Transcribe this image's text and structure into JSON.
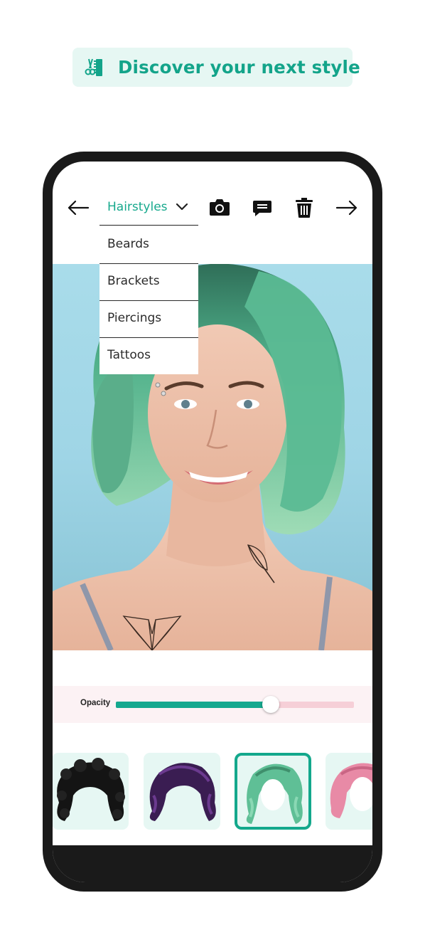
{
  "banner": {
    "icon": "scissors-comb-icon",
    "text": "Discover your next style",
    "color": "#13a48a",
    "background": "#e6f7f3"
  },
  "toolbar": {
    "back_icon": "arrow-left-icon",
    "forward_icon": "arrow-right-icon",
    "camera_icon": "camera-icon",
    "comment_icon": "comment-icon",
    "delete_icon": "trash-icon",
    "category_selected": "Hairstyles",
    "category_options": [
      "Beards",
      "Brackets",
      "Piercings",
      "Tattoos"
    ],
    "accent_color": "#17a98d"
  },
  "opacity": {
    "label": "Opacity",
    "value_fraction": 0.65,
    "fill_color": "#15a88e",
    "track_color": "#f6cfd7"
  },
  "styles": [
    {
      "name": "black curly hair",
      "selected": false
    },
    {
      "name": "purple wavy hair",
      "selected": false
    },
    {
      "name": "mint green wavy hair",
      "selected": true
    },
    {
      "name": "pink bob hair",
      "selected": false
    }
  ]
}
